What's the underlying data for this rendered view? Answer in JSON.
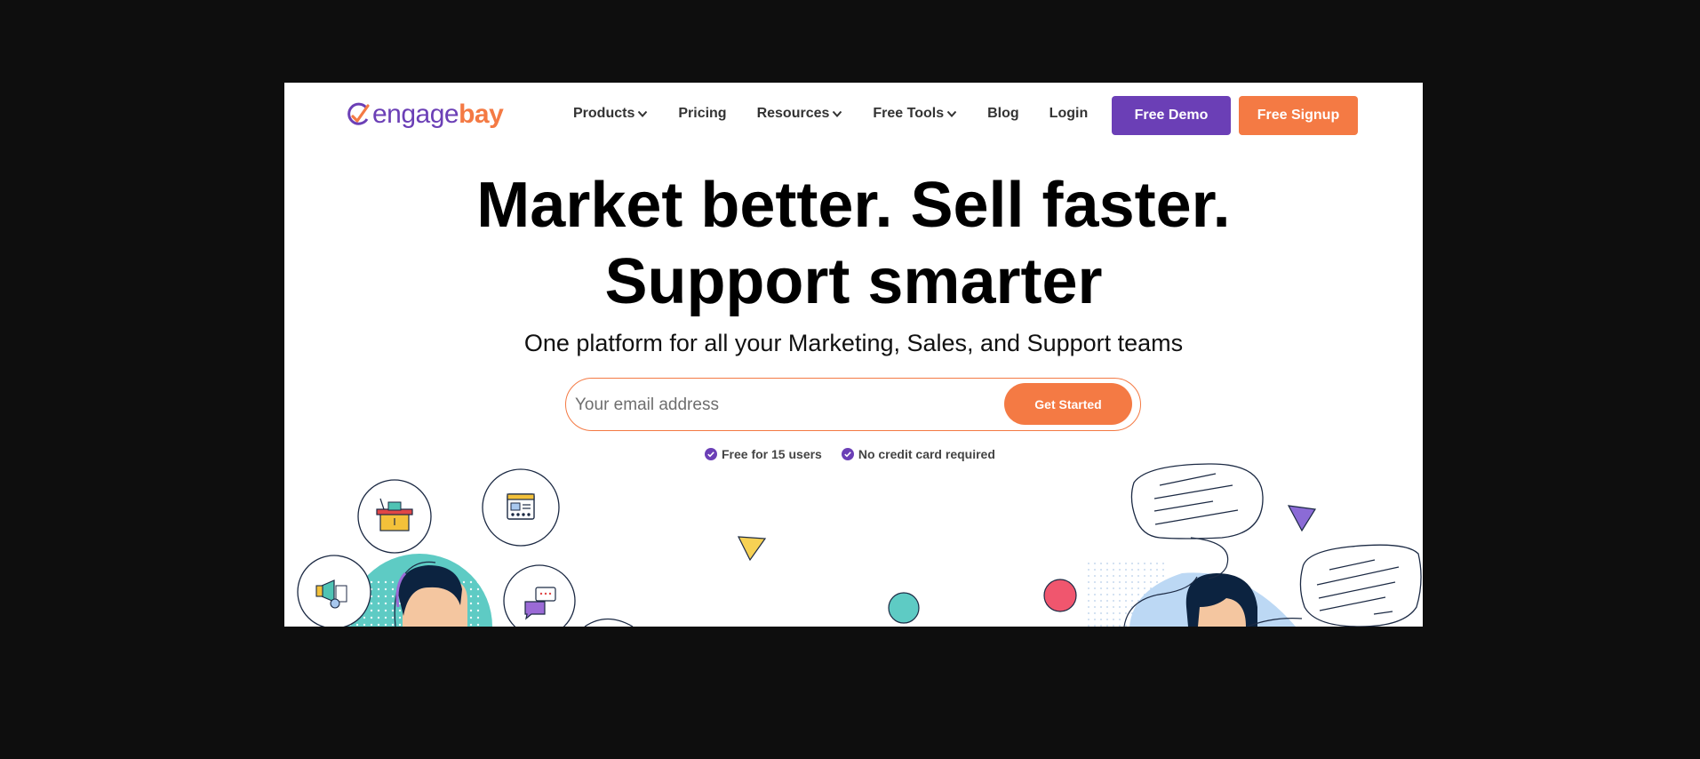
{
  "brand": {
    "logo_part1": "engage",
    "logo_part2": "bay"
  },
  "nav": {
    "items": [
      {
        "label": "Products",
        "has_dropdown": true
      },
      {
        "label": "Pricing",
        "has_dropdown": false
      },
      {
        "label": "Resources",
        "has_dropdown": true
      },
      {
        "label": "Free Tools",
        "has_dropdown": true
      },
      {
        "label": "Blog",
        "has_dropdown": false
      },
      {
        "label": "Login",
        "has_dropdown": false
      }
    ],
    "demo_label": "Free Demo",
    "signup_label": "Free Signup"
  },
  "hero": {
    "title_line1": "Market better. Sell faster.",
    "title_line2": "Support smarter",
    "subtitle": "One platform for all your Marketing, Sales, and Support teams",
    "email_placeholder": "Your email address",
    "cta_label": "Get Started",
    "benefits": [
      "Free for 15 users",
      "No credit card required"
    ]
  },
  "colors": {
    "primary": "#6b3fb6",
    "accent": "#f47a44",
    "teal": "#5ecbc4",
    "outer_background": "#0e0e0e"
  }
}
